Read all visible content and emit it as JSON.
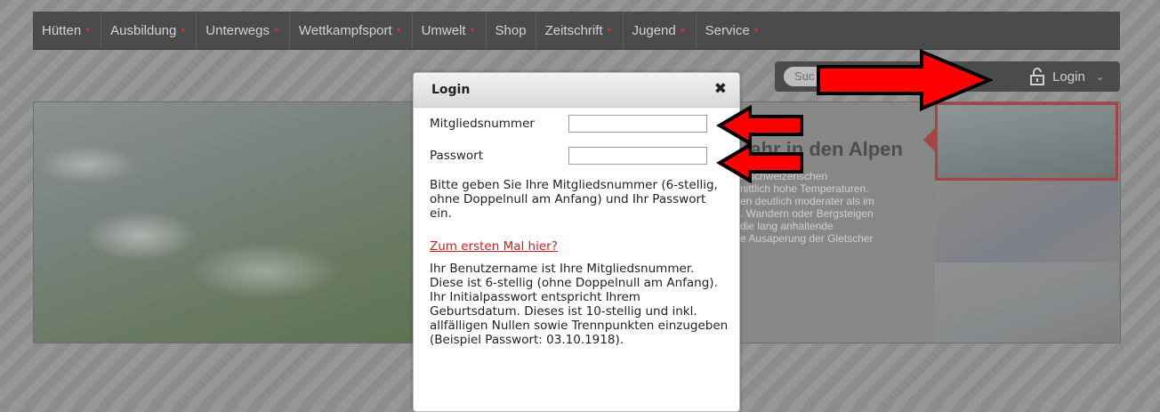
{
  "nav": {
    "items": [
      {
        "label": "Hütten"
      },
      {
        "label": "Ausbildung"
      },
      {
        "label": "Unterwegs"
      },
      {
        "label": "Wettkampfsport"
      },
      {
        "label": "Umwelt"
      },
      {
        "label": "Shop"
      },
      {
        "label": "Zeitschrift"
      },
      {
        "label": "Jugend"
      },
      {
        "label": "Service"
      }
    ]
  },
  "tools": {
    "search_placeholder": "Suc",
    "login_label": "Login"
  },
  "hero": {
    "title": "fahr in den Alpen",
    "desc_lines": [
      "n schweizerischen",
      "nittlich hohe Temperaturen.",
      "en deutlich moderater als im",
      ". Wandern oder Bergsteigen",
      "die lang anhaltende",
      "e Ausaperung der Gletscher"
    ]
  },
  "modal": {
    "title": "Login",
    "close_symbol": "✖",
    "member_label": "Mitgliedsnummer",
    "member_value": "",
    "password_label": "Passwort",
    "password_value": "",
    "instruction": "Bitte geben Sie Ihre Mitgliedsnummer (6-stellig, ohne Doppelnull am Anfang) und Ihr Passwort ein.",
    "first_time_link": "Zum ersten Mal hier?",
    "info": "Ihr Benutzername ist Ihre Mitgliedsnummer. Diese ist 6-stellig (ohne Doppelnull am Anfang). Ihr Initialpasswort entspricht Ihrem Geburtsdatum. Dieses ist 10-stellig und inkl. allfälligen Nullen sowie Trennpunkten einzugeben (Beispiel Passwort: 03.10.1918)."
  },
  "colors": {
    "nav_bg": "#4b4b4b",
    "accent_red": "#b23c3c",
    "link_red": "#cc1e1e",
    "arrow_red": "#ff0000"
  }
}
